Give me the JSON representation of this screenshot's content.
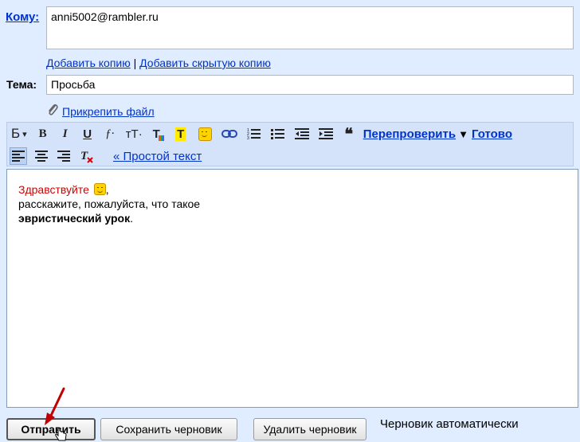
{
  "compose": {
    "to_label": "Кому:",
    "to_value": "anni5002@rambler.ru",
    "add_cc": "Добавить копию",
    "separator": "|",
    "add_bcc": "Добавить скрытую копию",
    "subject_label": "Тема:",
    "subject_value": "Просьба",
    "attach_label": "Прикрепить файл"
  },
  "toolbar": {
    "font_label": "Б",
    "dropdown_arrow": "▾",
    "bold": "B",
    "italic": "I",
    "underline": "U",
    "font_family": "ƒ·",
    "font_size": "тT·",
    "text_color": "T",
    "highlight": "T",
    "quote": "❝",
    "recheck_label": "Перепроверить",
    "recheck_arrow": "▼",
    "done_label": "Готово",
    "plain_text_label": "« Простой текст"
  },
  "body": {
    "line1": "Здравствуйте",
    "line1_suffix": ",",
    "line2": "расскажите, пожалуйста, что такое",
    "line3_bold": "эвристический урок",
    "line3_suffix": "."
  },
  "buttons": {
    "send": "Отправить",
    "save_draft": "Сохранить черновик",
    "delete_draft": "Удалить черновик"
  },
  "status": {
    "draft_note": "Черновик автоматически"
  },
  "colors": {
    "background": "#e0ecff",
    "link": "#0033cc",
    "greeting_red": "#d40000",
    "annotation_arrow": "#c00000"
  }
}
